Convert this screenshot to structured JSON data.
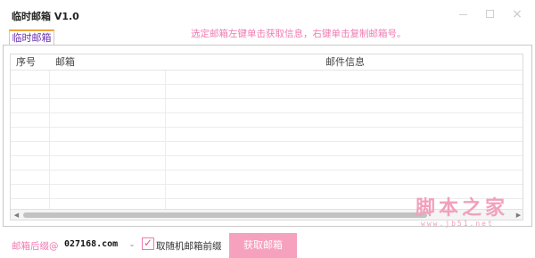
{
  "window": {
    "title": "临时邮箱  V1.0",
    "controls": {
      "minimize": "—",
      "close": "×"
    }
  },
  "tabs": [
    {
      "label": "临时邮箱",
      "active": true
    }
  ],
  "hint": "选定邮箱左键单击获取信息，右键单击复制邮箱号。",
  "list": {
    "columns": [
      "序号",
      "邮箱",
      "邮件信息"
    ],
    "rows": []
  },
  "scrollbar": {
    "left_arrow": "◀",
    "right_arrow": "▶"
  },
  "watermark": {
    "main": "脚本之家",
    "sub": "www.jb51.net"
  },
  "footer": {
    "suffix_label": "邮箱后缀@",
    "suffix_value": "027168.com",
    "suffix_arrow": "⌄",
    "random_prefix_label": "取随机邮箱前缀",
    "random_prefix_checked": true,
    "check_mark": "✓",
    "fetch_button": "获取邮箱"
  },
  "colors": {
    "accent_pink": "#f07ab0",
    "button_pink": "#f6a1bd",
    "tab_top_border": "#f0a33a",
    "tab_text": "#6a2fb3"
  }
}
